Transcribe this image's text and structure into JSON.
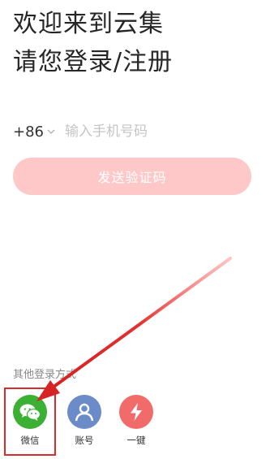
{
  "header": {
    "title_line1": "欢迎来到云集",
    "title_line2": "请您登录/注册"
  },
  "phone": {
    "country_code": "+86",
    "placeholder": "输入手机号码"
  },
  "send_button": {
    "label": "发送验证码"
  },
  "other_login": {
    "label": "其他登录方式",
    "methods": [
      {
        "label": "微信",
        "icon": "wechat-icon",
        "color": "#3cb034"
      },
      {
        "label": "账号",
        "icon": "user-icon",
        "color": "#6b8cc9"
      },
      {
        "label": "一键",
        "icon": "lightning-icon",
        "color": "#f26b6b"
      }
    ]
  },
  "annotation": {
    "highlight_color": "#d92b2b"
  }
}
